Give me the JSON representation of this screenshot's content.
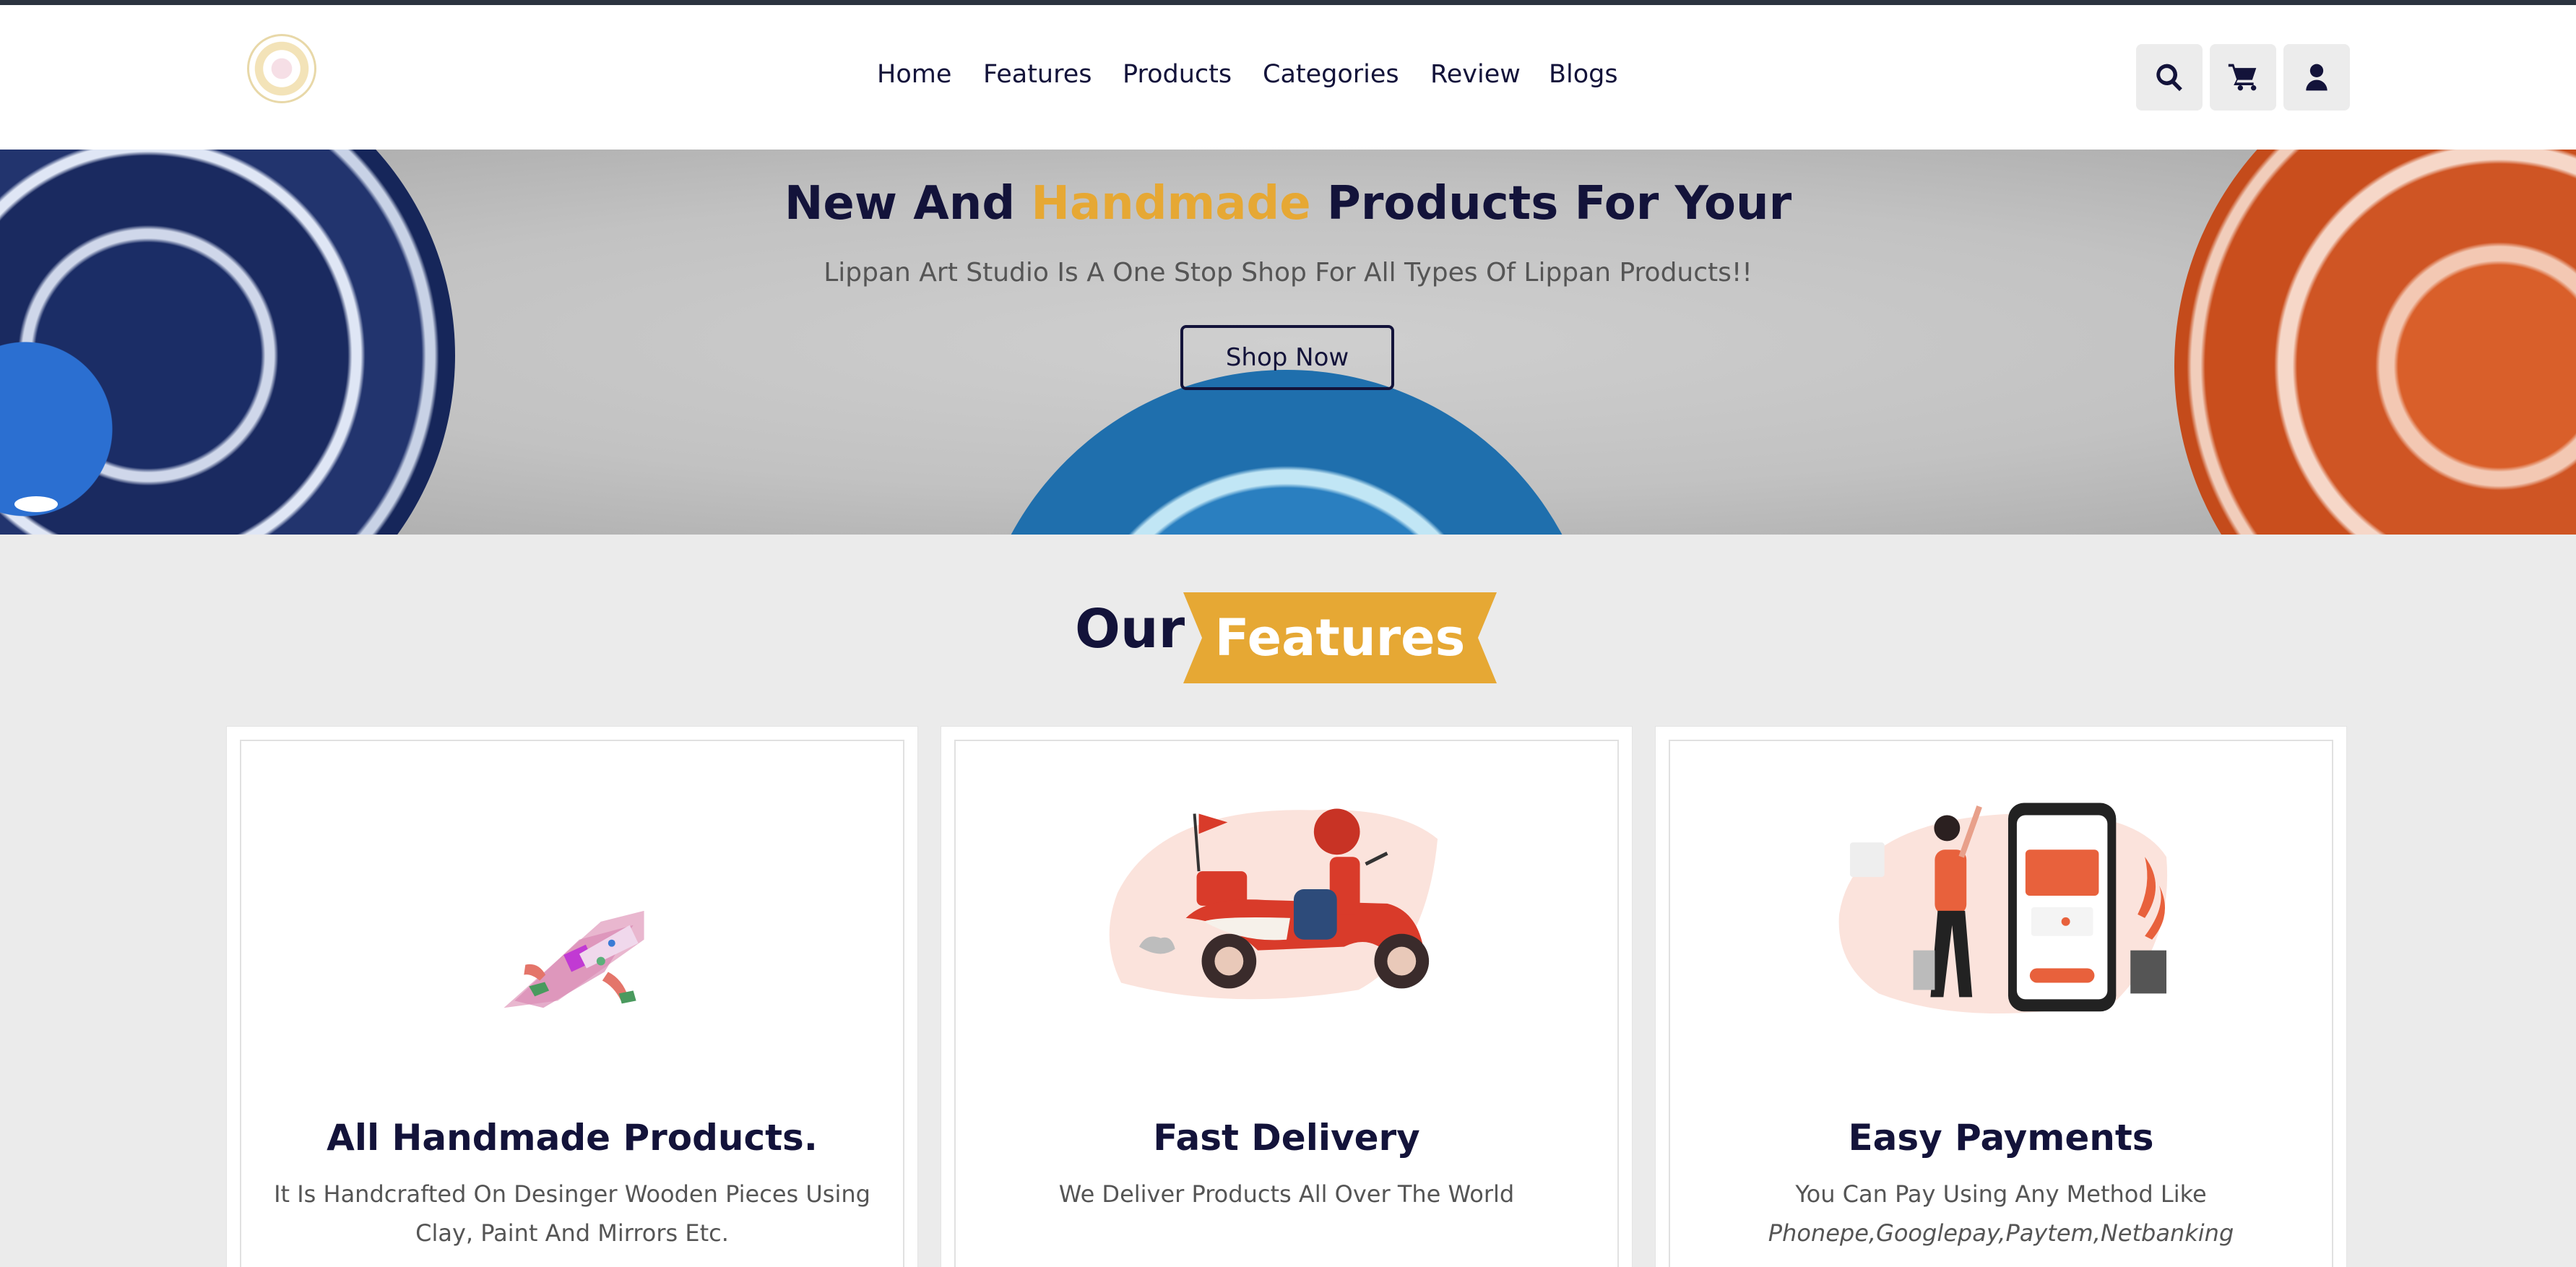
{
  "nav": {
    "items": [
      "Home",
      "Features",
      "Products",
      "Categories",
      "Review",
      "Blogs"
    ],
    "icons": [
      "search-icon",
      "cart-icon",
      "user-icon"
    ]
  },
  "hero": {
    "title_pre": "New And ",
    "title_highlight": "Handmade",
    "title_post": " Products For Your",
    "subtitle": "Lippan Art Studio Is A One Stop Shop For All Types Of Lippan Products!!",
    "button": "Shop Now"
  },
  "features_section": {
    "title_plain": "Our",
    "title_highlight": "Features"
  },
  "cards": [
    {
      "title": "All Handmade Products.",
      "desc": "It Is Handcrafted On Desinger Wooden Pieces Using Clay, Paint And Mirrors Etc.",
      "desc_italic": ""
    },
    {
      "title": "Fast Delivery",
      "desc": "We Deliver Products All Over The World",
      "desc_italic": ""
    },
    {
      "title": "Easy Payments",
      "desc": "You Can Pay Using Any Method Like",
      "desc_italic": "Phonepe,Googlepay,Paytem,Netbanking"
    }
  ],
  "colors": {
    "accent": "#e6a834",
    "navy": "#13133a",
    "page_bg": "#ebebeb"
  }
}
